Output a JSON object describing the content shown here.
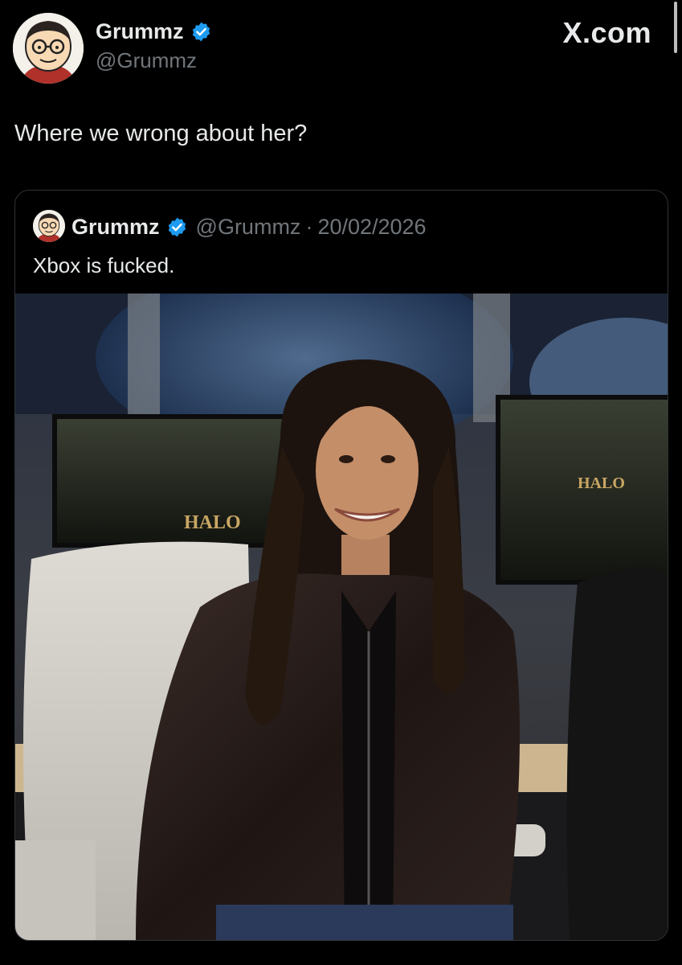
{
  "author": {
    "display_name": "Grummz",
    "handle": "@Grummz",
    "verified_icon": "verified-badge-icon",
    "avatar_icon": "cartoon-face-avatar"
  },
  "brand": {
    "label": "X.com"
  },
  "tweet": {
    "text": "Where we wrong about her?"
  },
  "quoted_tweet": {
    "display_name": "Grummz",
    "handle": "@Grummz",
    "separator": "·",
    "date": "20/02/2026",
    "text": "Xbox is fucked."
  },
  "media": {
    "monitor_left_text": "HALO",
    "monitor_right_text": "HALO"
  },
  "colors": {
    "background": "#000000",
    "primary_text": "#e7e9ea",
    "secondary_text": "#71767b",
    "verified_blue": "#1d9bf0",
    "card_border": "#2f3336"
  }
}
